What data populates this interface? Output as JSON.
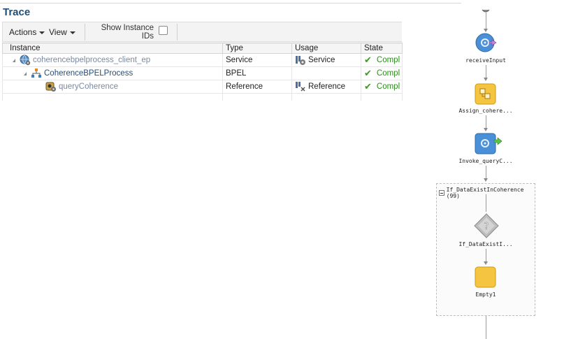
{
  "trace": {
    "title": "Trace",
    "toolbar": {
      "actions_label": "Actions",
      "view_label": "View",
      "show_ids_label": "Show Instance IDs",
      "show_ids_checked": false
    },
    "columns": {
      "instance": "Instance",
      "type": "Type",
      "usage": "Usage",
      "state": "State"
    },
    "rows": [
      {
        "instance": "coherencebpelprocess_client_ep",
        "type": "Service",
        "usage": "Service",
        "state": "Compl",
        "icon": "globe-service-icon",
        "usage_icon": "service-gear-icon"
      },
      {
        "instance": "CoherenceBPELProcess",
        "type": "BPEL",
        "usage": "",
        "state": "Compl",
        "icon": "bpel-process-icon",
        "usage_icon": ""
      },
      {
        "instance": "queryCoherence",
        "type": "Reference",
        "usage": "Reference",
        "state": "Compl",
        "icon": "reference-adapter-icon",
        "usage_icon": "reference-arrow-icon"
      }
    ]
  },
  "flow": {
    "nodes": [
      {
        "label": "receiveInput",
        "icon": "receive-icon"
      },
      {
        "label": "Assign_cohere...",
        "icon": "assign-icon"
      },
      {
        "label": "Invoke_queryC...",
        "icon": "invoke-icon"
      }
    ],
    "scope": {
      "title": "If_DataExistInCoherence (99)",
      "nodes": [
        {
          "label": "If_DataExistI...",
          "icon": "if-condition-icon"
        },
        {
          "label": "Empty1",
          "icon": "empty-activity-icon"
        }
      ]
    }
  },
  "colors": {
    "title": "#1f4e79",
    "ok": "#3c9a1c",
    "activity_blue": "#4a90d9",
    "activity_yellow": "#f5c542"
  }
}
